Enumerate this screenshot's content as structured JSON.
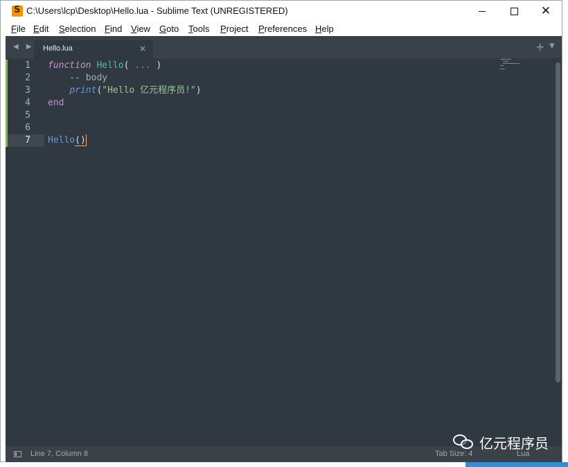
{
  "window": {
    "title": "C:\\Users\\lcp\\Desktop\\Hello.lua - Sublime Text (UNREGISTERED)",
    "close_glyph": "✕"
  },
  "menu": [
    {
      "label": "File"
    },
    {
      "label": "Edit"
    },
    {
      "label": "Selection"
    },
    {
      "label": "Find"
    },
    {
      "label": "View"
    },
    {
      "label": "Goto"
    },
    {
      "label": "Tools"
    },
    {
      "label": "Project"
    },
    {
      "label": "Preferences"
    },
    {
      "label": "Help"
    }
  ],
  "tabbar": {
    "nav_arrows": "◀ ▶",
    "tabs": [
      {
        "label": "Hello.lua",
        "close": "×",
        "active": true
      }
    ],
    "new_tab": "+",
    "tab_list": "▼"
  },
  "editor": {
    "line_numbers": [
      "1",
      "2",
      "3",
      "4",
      "5",
      "6",
      "7"
    ],
    "current_line": "7",
    "code": {
      "l1_kw": "function",
      "l1_name": "Hello",
      "l1_open": "( ",
      "l1_dots": "...",
      "l1_close": " )",
      "l2_comment": "    -- body",
      "l3_indent": "    ",
      "l3_fn": "print",
      "l3_open": "(",
      "l3_str": "\"Hello 亿元程序员!\"",
      "l3_close": ")",
      "l4_kw": "end",
      "l7_call": "Hello",
      "l7_open": "(",
      "l7_close": ")"
    }
  },
  "statusbar": {
    "position": "Line 7, Column 8",
    "tab_size": "Tab Size: 4",
    "syntax": "Lua"
  },
  "watermark": {
    "text": "亿元程序员"
  },
  "colors": {
    "editor_bg": "#303841",
    "chrome_bg": "#3b4148",
    "keyword": "#c594c5",
    "function": "#5fb3b3",
    "string": "#99c794",
    "accent_cursor": "#f9ae58"
  },
  "icons": {
    "app": "sublime-text-icon",
    "statusbar_panel": "panel-toggle-icon",
    "watermark": "wechat-icon"
  }
}
